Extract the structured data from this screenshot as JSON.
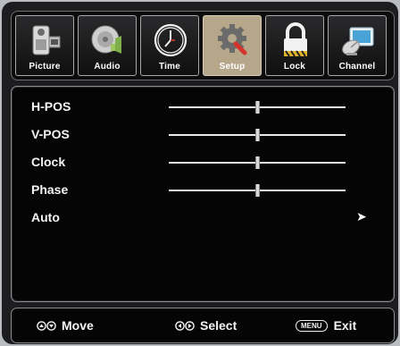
{
  "tabs": [
    {
      "id": "picture",
      "label": "Picture",
      "icon": "picture-camera-icon",
      "active": false
    },
    {
      "id": "audio",
      "label": "Audio",
      "icon": "audio-speaker-icon",
      "active": false
    },
    {
      "id": "time",
      "label": "Time",
      "icon": "clock-icon",
      "active": false
    },
    {
      "id": "setup",
      "label": "Setup",
      "icon": "gear-wrench-icon",
      "active": true
    },
    {
      "id": "lock",
      "label": "Lock",
      "icon": "padlock-icon",
      "active": false
    },
    {
      "id": "channel",
      "label": "Channel",
      "icon": "satellite-dish-icon",
      "active": false
    }
  ],
  "settings": [
    {
      "label": "H-POS",
      "type": "slider",
      "level": 0.5
    },
    {
      "label": "V-POS",
      "type": "slider",
      "level": 0.5
    },
    {
      "label": "Clock",
      "type": "slider",
      "level": 0.5
    },
    {
      "label": "Phase",
      "type": "slider",
      "level": 0.5
    },
    {
      "label": "Auto",
      "type": "action",
      "arrow": "➤"
    }
  ],
  "footer": {
    "move_label": "Move",
    "select_label": "Select",
    "menu_key": "MENU",
    "exit_label": "Exit"
  },
  "colors": {
    "active_tab": "#b6a78a",
    "background": "#050505",
    "text": "#f4f4f4"
  }
}
